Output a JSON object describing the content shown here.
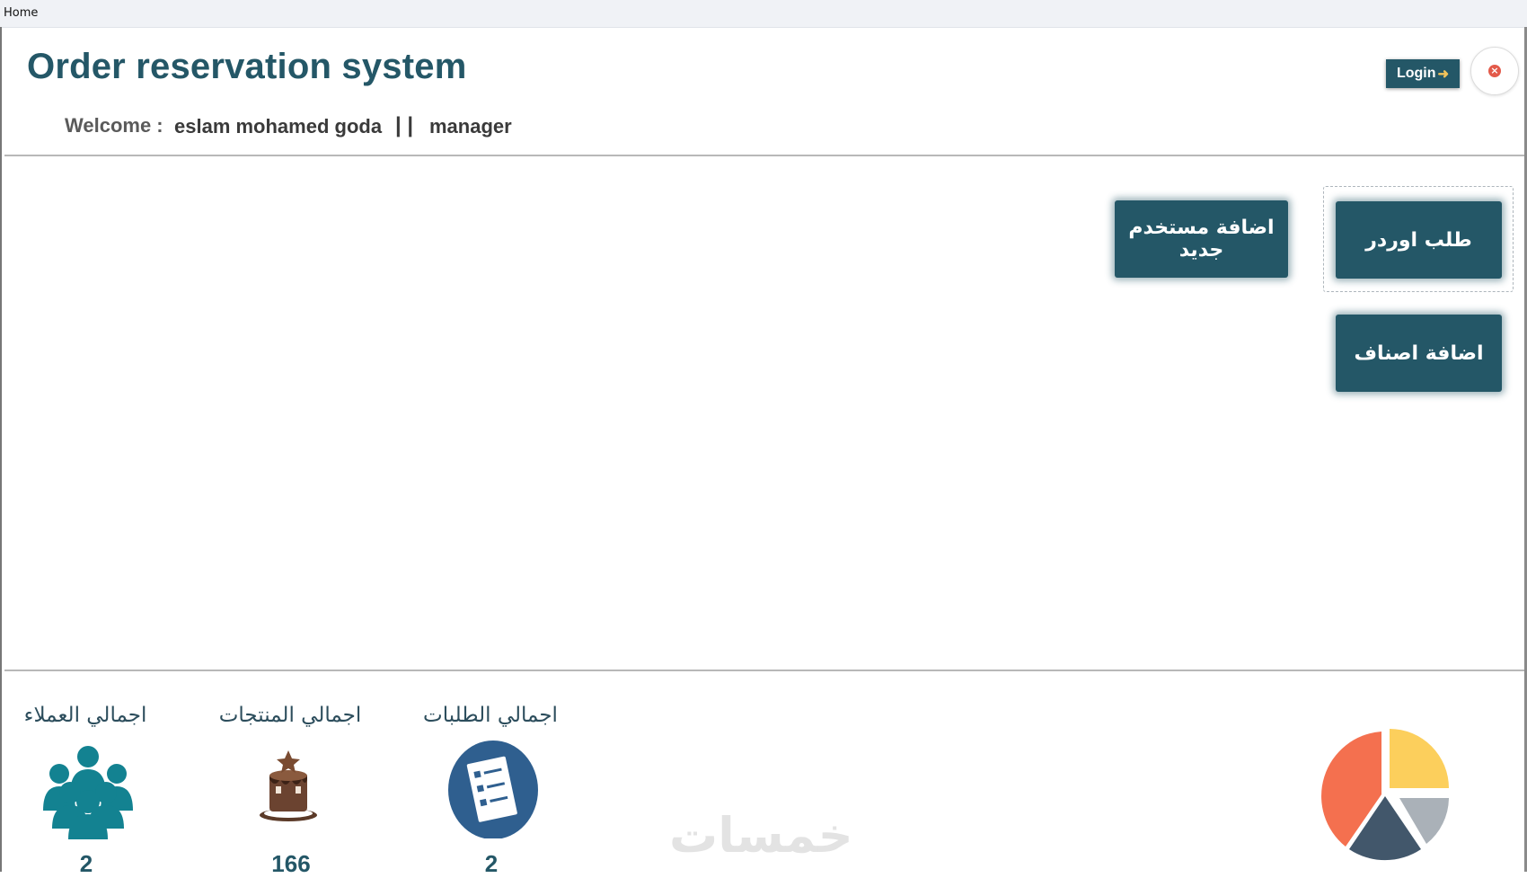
{
  "window": {
    "title": "Home"
  },
  "header": {
    "app_title": "Order reservation system",
    "welcome_label": "Welcome :",
    "user_name": "eslam mohamed goda",
    "separator": "| |",
    "user_role": "manager",
    "login_label": "Login"
  },
  "actions": {
    "order_label": "طلب اوردر",
    "add_user_label": "اضافة مستخدم جديد",
    "add_items_label": "اضافة اصناف"
  },
  "stats": {
    "customers": {
      "label": "اجمالي العملاء",
      "value": "2",
      "icon": "users-icon"
    },
    "products": {
      "label": "اجمالي المنتجات",
      "value": "166",
      "icon": "cake-icon"
    },
    "orders": {
      "label": "اجمالي الطلبات",
      "value": "2",
      "icon": "checklist-icon"
    }
  },
  "watermark": "خمسات",
  "colors": {
    "primary": "#245767",
    "chart_yellow": "#fccf5c",
    "chart_coral": "#f4704f",
    "chart_navy": "#42576b",
    "chart_gray": "#aab1b8"
  }
}
